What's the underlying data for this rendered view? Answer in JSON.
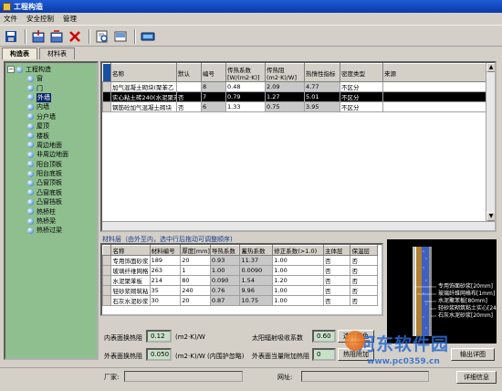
{
  "window": {
    "title": "工程构造"
  },
  "menu": {
    "items": [
      "文件",
      "安全控制",
      "管理"
    ]
  },
  "toolbar": {
    "icons": [
      "save-icon",
      "import-icon",
      "export-icon",
      "delete-icon",
      "preview-icon",
      "print-icon",
      "link-icon"
    ]
  },
  "tabs": [
    {
      "label": "构造表"
    },
    {
      "label": "材料表"
    }
  ],
  "tree": {
    "root": "工程构造",
    "selected": "外墙",
    "items": [
      "窗",
      "门",
      "外墙",
      "内墙",
      "分户墙",
      "屋顶",
      "楼板",
      "周边地面",
      "非周边地面",
      "阳台顶板",
      "阳台底板",
      "凸窗顶板",
      "凸窗底板",
      "凸窗挡板",
      "热桥柱",
      "热桥梁",
      "热桥过梁"
    ]
  },
  "construction_table": {
    "headers": [
      "名称",
      "默认",
      "编号",
      "传热系数\n[W/(m2·K)]",
      "传热阻\n(m2·K)/W]",
      "热惰性指标",
      "密度类型",
      "来源"
    ],
    "header_lines": [
      [
        "名称"
      ],
      [
        "默认"
      ],
      [
        "编号"
      ],
      [
        "传热系数",
        "[W/(m2·K)]"
      ],
      [
        "传热阻",
        "(m2·K)/W]"
      ],
      [
        "热惰性指标"
      ],
      [
        "密度类型"
      ],
      [
        "来源"
      ]
    ],
    "rows": [
      {
        "name": "加气混凝土砌块(聚苯乙",
        "default": "",
        "id": "8",
        "k": "0.48",
        "r": "2.09",
        "d": "4.77",
        "density": "不区分",
        "source": "",
        "selected": false
      },
      {
        "name": "实心粘土砖240(水泥聚苯",
        "default": "否",
        "id": "7",
        "k": "0.79",
        "r": "1.27",
        "d": "5.01",
        "density": "不区分",
        "source": "",
        "selected": true
      },
      {
        "name": "钢筋砼加气混凝土砌块",
        "default": "否",
        "id": "6",
        "k": "1.33",
        "r": "0.75",
        "r2": "",
        "d": "3.95",
        "density": "不区分",
        "source": "",
        "selected": false
      }
    ]
  },
  "material_section": {
    "title": "材料层（由外至内，选中行后拖动可调整顺序)",
    "headers": [
      "名称",
      "材料编号",
      "厚度[mm]",
      "导热系数",
      "蓄热系数",
      "修正系数(>1.0)",
      "主体层",
      "保温层"
    ],
    "rows": [
      [
        "专用饰面砂浆",
        "189",
        "20",
        "0.93",
        "11.37",
        "1.00",
        "否",
        "否"
      ],
      [
        "玻璃纤维网格",
        "263",
        "1",
        "1.00",
        "0.0090",
        "1.00",
        "否",
        "否"
      ],
      [
        "水泥聚苯板",
        "214",
        "80",
        "0.090",
        "1.54",
        "1.20",
        "否",
        "否"
      ],
      [
        "轻砂浆砌筑粘",
        "35",
        "240",
        "0.76",
        "9.96",
        "1.00",
        "否",
        "否"
      ],
      [
        "石灰水泥砂浆",
        "30",
        "20",
        "0.87",
        "10.75",
        "1.00",
        "否",
        "否"
      ]
    ]
  },
  "preview": {
    "labels": [
      "专用饰面砂浆[20mm]",
      "玻璃纤维网格布[1mm]",
      "水泥聚苯板[80mm]",
      "轻砂浆砌筑粘土实心[24",
      "石灰水泥砂浆[20mm]"
    ]
  },
  "params": {
    "inner_label": "内表面换热阻",
    "inner_value": "0.12",
    "inner_unit": "(m2·K)/W",
    "outer_label": "外表面换热阻",
    "outer_value": "0.050",
    "outer_unit": "(m2·K)/W (内围护忽略)",
    "solar_label": "太阳辐射吸收系数",
    "solar_value": "0.60",
    "thermal_label": "外表面当量附加热阻",
    "thermal_value": "0",
    "refresh_btn": "选择颜色",
    "thermal_btn": "热阻附加",
    "export_btn": "输出详图"
  },
  "status": {
    "vendor_label": "厂家:",
    "url_label": "网址:",
    "detail_btn": "详细信息"
  },
  "watermark": {
    "text": "河东软件园",
    "url": "www.pc0359.cn"
  }
}
